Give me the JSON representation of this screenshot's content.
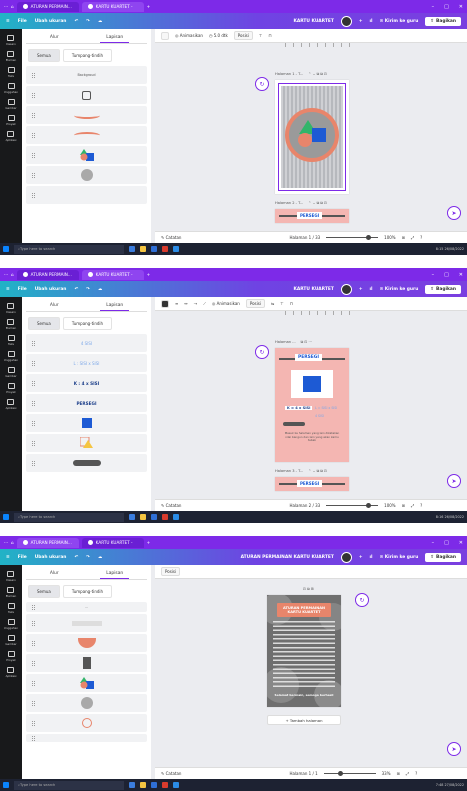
{
  "panels": [
    {
      "browser_tabs": [
        "ATURAN PERMAIN...",
        "KARTU KUARTET -"
      ],
      "menu": {
        "file": "File",
        "resize": "Ubah ukuran",
        "doc_title": "KARTU KUARTET",
        "send": "Kirim ke guru",
        "share": "Bagikan"
      },
      "side_tabs": [
        "Alur",
        "Lapisan"
      ],
      "filters": [
        "Semua",
        "Tumpang-tindih"
      ],
      "layers": [
        "Backgroud",
        "",
        "",
        "",
        "",
        "",
        ""
      ],
      "toolbar": [
        "Animasikan",
        "5.0 dtk",
        "Posisi"
      ],
      "page_labels": [
        "Halaman 1 - T...",
        "Halaman 2 - T..."
      ],
      "page2_title": "PERSEGI",
      "notes": "Catatan",
      "page_count": "Halaman 1 / 33",
      "zoom": "100%",
      "taskbar_search": "Type here to search",
      "clock": "8:15 26/08/2022",
      "colors": {
        "purple": "#7d2ae8",
        "teal": "#21b3c6",
        "salmon": "#e8856b",
        "blue": "#1d5ad4",
        "green": "#32b56a"
      }
    },
    {
      "browser_tabs": [
        "ATURAN PERMAIN...",
        "KARTU KUARTET -"
      ],
      "menu": {
        "file": "File",
        "resize": "Ubah ukuran",
        "doc_title": "KARTU KUARTET",
        "send": "Kirim ke guru",
        "share": "Bagikan"
      },
      "side_tabs": [
        "Alur",
        "Lapisan"
      ],
      "filters": [
        "Semua",
        "Tumpang-tindih"
      ],
      "layers": [
        "4 SISI",
        "L : SISI x SISI",
        "K : 4 x SISI",
        "PERSEGI",
        "",
        "",
        ""
      ],
      "toolbar": [
        "Animasikan",
        "Posisi"
      ],
      "page_labels": [
        "Halaman ...",
        "Halaman 3 - T..."
      ],
      "page_title": "PERSEGI",
      "card_lines": [
        "K = 4 x SISI",
        "L = SISI x SISI",
        "4 SISI"
      ],
      "card_caption": "Masuk ke halaman yang lain dikatakan nilai bangun dan lain yang akan kamu tebak",
      "page3_title": "PERSEGI",
      "notes": "Catatan",
      "page_count": "Halaman 2 / 33",
      "zoom": "100%",
      "taskbar_search": "Type here to search",
      "clock": "8:16 26/08/2022"
    },
    {
      "browser_tabs": [
        "ATURAN PERMAIN...",
        "KARTU KUARTET -"
      ],
      "menu": {
        "file": "File",
        "resize": "Ubah ukuran",
        "doc_title": "ATURAN PERMAINAN KARTU KUARTET",
        "send": "Kirim ke guru",
        "share": "Bagikan"
      },
      "side_tabs": [
        "Alur",
        "Lapisan"
      ],
      "filters": [
        "Semua",
        "Tumpang-tindih"
      ],
      "layers": [
        "...",
        "",
        "",
        "",
        "",
        "",
        "",
        ""
      ],
      "toolbar": [
        "Posisi"
      ],
      "rules_title": "ATURAN PERMAINAN KARTU KUARTET",
      "rules_footer": "Selamat bermain, semoga berhasil",
      "add_page": "+ Tambah halaman",
      "notes": "Catatan",
      "page_count": "Halaman 1 / 1",
      "zoom": "33%",
      "taskbar_search": "Type here to search",
      "clock": "7:48 27/08/2022"
    }
  ],
  "rail_items": [
    "Desain",
    "Elemen",
    "Teks",
    "Unggahan",
    "Gambar",
    "Proyek",
    "Aplikasi"
  ]
}
